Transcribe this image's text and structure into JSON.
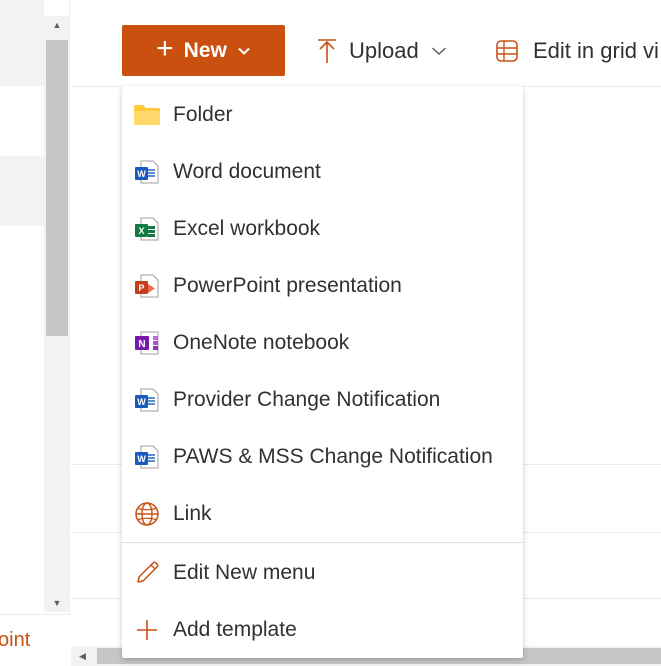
{
  "left_nav": {
    "footer_text": "oint"
  },
  "command_bar": {
    "new_label": "New",
    "upload_label": "Upload",
    "edit_grid_label": "Edit in grid vi"
  },
  "new_menu": {
    "items": [
      {
        "label": "Folder",
        "icon": "folder-icon"
      },
      {
        "label": "Word document",
        "icon": "word-icon"
      },
      {
        "label": "Excel workbook",
        "icon": "excel-icon"
      },
      {
        "label": "PowerPoint presentation",
        "icon": "powerpoint-icon"
      },
      {
        "label": "OneNote notebook",
        "icon": "onenote-icon"
      },
      {
        "label": "Provider Change Notification",
        "icon": "word-icon"
      },
      {
        "label": "PAWS & MSS Change Notification",
        "icon": "word-icon"
      },
      {
        "label": "Link",
        "icon": "globe-icon"
      }
    ],
    "footer_items": [
      {
        "label": "Edit New menu",
        "icon": "pencil-icon"
      },
      {
        "label": "Add template",
        "icon": "plus-icon"
      }
    ]
  },
  "colors": {
    "accent": "#ca5010",
    "word": "#185abd",
    "excel": "#107c41",
    "powerpoint": "#c43e1c",
    "onenote": "#7719aa",
    "folder": "#ffc83d"
  }
}
